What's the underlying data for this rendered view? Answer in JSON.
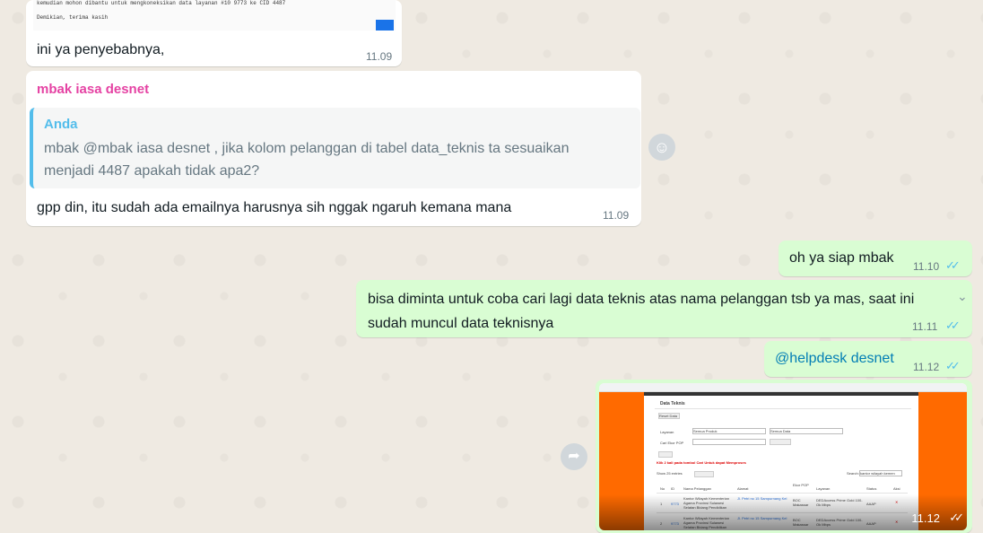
{
  "messages": {
    "m1": {
      "doc_line1": "kemudian mohon dibantu untuk mengkoneksikan data layanan #10 9773 ke CID 4487",
      "doc_line2": "Demikian, terima kasih",
      "text": "ini ya penyebabnya,",
      "time": "11.09"
    },
    "m2": {
      "sender": "mbak iasa desnet",
      "quote_name": "Anda",
      "quote_text": "mbak @mbak iasa desnet , jika kolom pelanggan di tabel data_teknis ta sesuaikan menjadi 4487 apakah tidak apa2?",
      "text": "gpp din, itu sudah ada emailnya harusnya sih nggak ngaruh kemana mana",
      "time": "11.09"
    },
    "m3": {
      "text": "oh ya siap mbak",
      "time": "11.10"
    },
    "m4": {
      "text": "bisa diminta untuk coba cari lagi data teknis atas nama pelanggan tsb ya mas, saat ini sudah muncul data teknisnya",
      "time": "11.11"
    },
    "m5": {
      "text": "@helpdesk desnet",
      "time": "11.12"
    },
    "m6": {
      "time": "11.12",
      "screenshot": {
        "page_title": "Data Teknis",
        "reset_button": "Reset Data",
        "label_layanan": "Layanan",
        "label_cari": "Cari Ekor POP",
        "select1": "Semua Produk",
        "select2": "Semua Data",
        "warning": "Klik 2 kali pada tombol Cari Untuk dapat Memproses",
        "show_label": "Show 25 entries",
        "search_label": "Search:",
        "search_value": "kantor wilayah kemen",
        "columns": [
          "No",
          "ID",
          "Nama Pelanggan",
          "Alamat",
          "Ekor POP",
          "Layanan",
          "Status",
          "Aksi"
        ],
        "rows": [
          [
            "1",
            "9773",
            "Kantor Wilayah Kementerian Agama Provinsi Sulawesi Selatan Bidang Pendidikan",
            "Jl. Petri no 15 Sampurnang Kel",
            "BOC Makassar",
            "DEDAccess Prime Gold 100-Ok Mbps",
            "AAAP"
          ],
          [
            "2",
            "9773",
            "Kantor Wilayah Kementerian Agama Provinsi Sulawesi Selatan Bidang Pendidikan",
            "Jl. Petri no 15 Sampurnang Kel",
            "BOC Makassar",
            "DEDAccess Prime Gold 100-Ok Mbps",
            "AAAP"
          ]
        ]
      }
    }
  },
  "icons": {
    "react": "smiley-icon",
    "forward": "forward-arrow-icon",
    "read": "double-check-icon",
    "menu": "chevron-down-icon"
  },
  "colors": {
    "incoming": "#ffffff",
    "outgoing": "#d9fdd3",
    "sender_name": "#e542a3",
    "quote_name": "#06cf9c",
    "read_ticks": "#53bdeb",
    "background": "#efeae2"
  }
}
